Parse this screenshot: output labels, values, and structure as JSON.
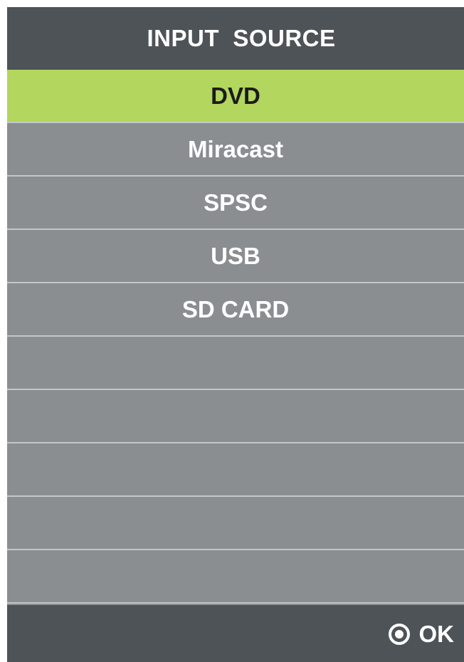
{
  "menu": {
    "title": "INPUT  SOURCE",
    "selected_index": 0,
    "items": [
      {
        "label": "DVD"
      },
      {
        "label": "Miracast"
      },
      {
        "label": "SPSC"
      },
      {
        "label": "USB"
      },
      {
        "label": "SD CARD"
      },
      {
        "label": ""
      },
      {
        "label": ""
      },
      {
        "label": ""
      },
      {
        "label": ""
      },
      {
        "label": ""
      }
    ]
  },
  "footer": {
    "ok_label": "OK",
    "ok_icon": "circle-dot-icon"
  },
  "colors": {
    "header_bg": "#4d5356",
    "list_bg": "#8b8e91",
    "selected_bg": "#b2d65e",
    "separator": "#c4c6c8",
    "text": "#ffffff",
    "selected_text": "#1b1b1b"
  }
}
